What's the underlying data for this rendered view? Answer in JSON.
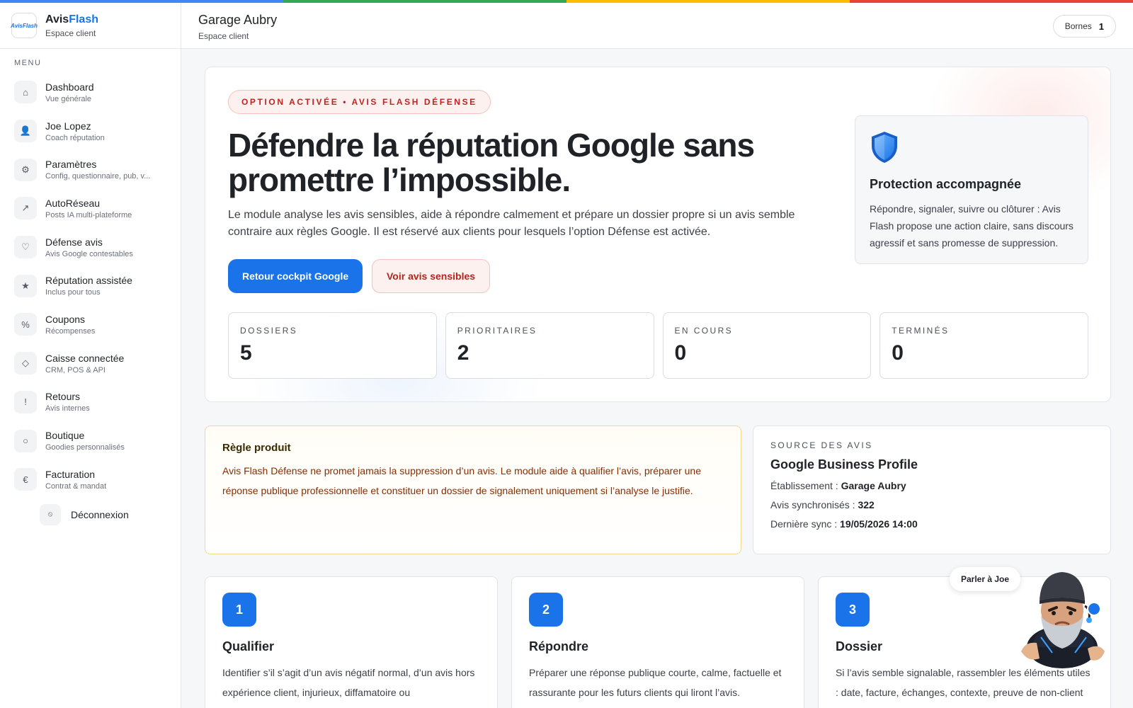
{
  "colors": {
    "stripe": [
      "#4285f4",
      "#34a853",
      "#fbbc05",
      "#ea4335"
    ],
    "primary": "#1a73e8",
    "danger": "#c5221f"
  },
  "brand": {
    "logo_text": "AvisFlash",
    "name_a": "Avis",
    "name_b": "Flash",
    "subtitle": "Espace client"
  },
  "sidebar": {
    "menu_heading": "MENU",
    "items": [
      {
        "icon": "home-icon",
        "glyph": "⌂",
        "title": "Dashboard",
        "subtitle": "Vue générale"
      },
      {
        "icon": "coach-avatar-icon",
        "glyph": "👤",
        "title": "Joe Lopez",
        "subtitle": "Coach réputation"
      },
      {
        "icon": "gear-icon",
        "glyph": "⚙",
        "title": "Paramètres",
        "subtitle": "Config, questionnaire, pub, v..."
      },
      {
        "icon": "arrow-up-right-icon",
        "glyph": "↗",
        "title": "AutoRéseau",
        "subtitle": "Posts IA multi-plateforme"
      },
      {
        "icon": "shield-icon",
        "glyph": "♡",
        "title": "Défense avis",
        "subtitle": "Avis Google contestables"
      },
      {
        "icon": "star-icon",
        "glyph": "★",
        "title": "Réputation assistée",
        "subtitle": "Inclus pour tous"
      },
      {
        "icon": "percent-icon",
        "glyph": "%",
        "title": "Coupons",
        "subtitle": "Récompenses"
      },
      {
        "icon": "diamond-icon",
        "glyph": "◇",
        "title": "Caisse connectée",
        "subtitle": "CRM, POS & API"
      },
      {
        "icon": "exclamation-icon",
        "glyph": "!",
        "title": "Retours",
        "subtitle": "Avis internes"
      },
      {
        "icon": "circle-icon",
        "glyph": "○",
        "title": "Boutique",
        "subtitle": "Goodies personnalisés"
      },
      {
        "icon": "euro-icon",
        "glyph": "€",
        "title": "Facturation",
        "subtitle": "Contrat & mandat"
      }
    ],
    "logout": {
      "glyph": "⦸",
      "label": "Déconnexion"
    }
  },
  "header": {
    "title": "Garage Aubry",
    "subtitle": "Espace client",
    "bornes_label": "Bornes",
    "bornes_count": "1"
  },
  "hero": {
    "pill": "OPTION ACTIVÉE • AVIS FLASH DÉFENSE",
    "title": "Défendre la réputation Google sans promettre l’impossible.",
    "description": "Le module analyse les avis sensibles, aide à répondre calmement et prépare un dossier propre si un avis semble contraire aux règles Google. Il est réservé aux clients pour lesquels l’option Défense est activée.",
    "btn_primary": "Retour cockpit Google",
    "btn_secondary": "Voir avis sensibles",
    "protect_title": "Protection accompagnée",
    "protect_text": "Répondre, signaler, suivre ou clôturer : Avis Flash propose une action claire, sans discours agressif et sans promesse de suppression.",
    "stats": [
      {
        "label": "DOSSIERS",
        "value": "5"
      },
      {
        "label": "PRIORITAIRES",
        "value": "2"
      },
      {
        "label": "EN COURS",
        "value": "0"
      },
      {
        "label": "TERMINÉS",
        "value": "0"
      }
    ]
  },
  "rule": {
    "title": "Règle produit",
    "text": "Avis Flash Défense ne promet jamais la suppression d’un avis. Le module aide à qualifier l’avis, préparer une réponse publique professionnelle et constituer un dossier de signalement uniquement si l’analyse le justifie."
  },
  "source": {
    "label": "SOURCE DES AVIS",
    "title": "Google Business Profile",
    "etab_label": "Établissement :",
    "etab_value": "Garage Aubry",
    "sync_label": "Avis synchronisés :",
    "sync_value": "322",
    "last_label": "Dernière sync :",
    "last_value": "19/05/2026 14:00"
  },
  "steps": [
    {
      "num": "1",
      "title": "Qualifier",
      "text": "Identifier s’il s’agit d’un avis négatif normal, d’un avis hors expérience client, injurieux, diffamatoire ou"
    },
    {
      "num": "2",
      "title": "Répondre",
      "text": "Préparer une réponse publique courte, calme, factuelle et rassurante pour les futurs clients qui liront l’avis."
    },
    {
      "num": "3",
      "title": "Dossier",
      "text": "Si l’avis semble signalable, rassembler les éléments utiles : date, facture, échanges, contexte, preuve de non-client"
    }
  ],
  "chat": {
    "bubble": "Parler à Joe"
  }
}
